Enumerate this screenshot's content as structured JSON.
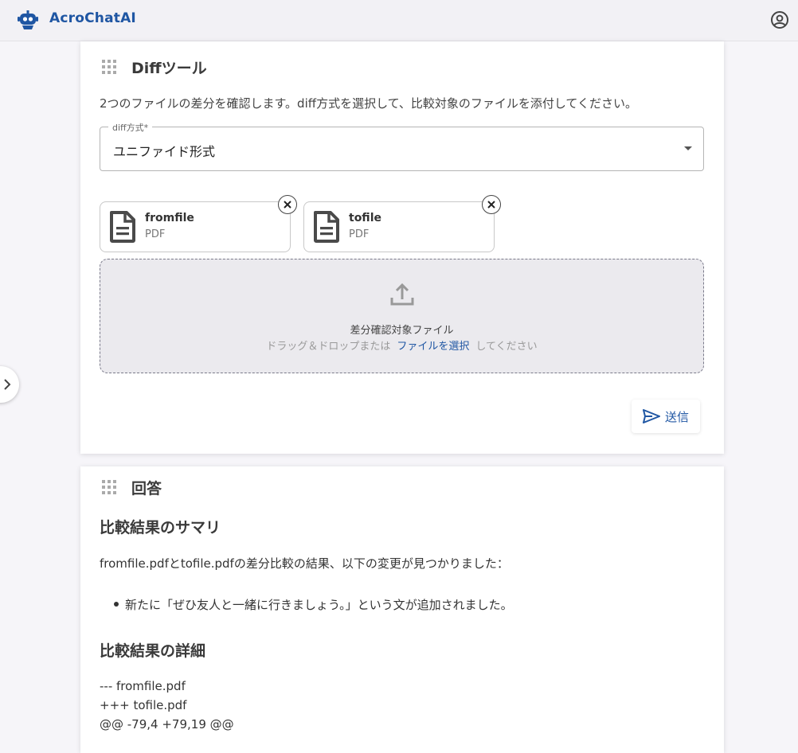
{
  "appbar": {
    "brand_name": "AcroChatAI",
    "logo_icon": "robot-icon",
    "account_icon": "account-circle-icon",
    "brand_color": "#1f56a3"
  },
  "side_toggle": {
    "icon": "chevron-right-icon"
  },
  "tool_card": {
    "title": "Diffツール",
    "description": "2つのファイルの差分を確認します。diff方式を選択して、比較対象のファイルを添付してください。",
    "select": {
      "label": "diff方式*",
      "value": "ユニファイド形式"
    },
    "files": [
      {
        "name": "fromfile",
        "type": "PDF"
      },
      {
        "name": "tofile",
        "type": "PDF"
      }
    ],
    "dropzone": {
      "title": "差分確認対象ファイル",
      "hint_before": "ドラッグ＆ドロップまたは",
      "hint_link": "ファイルを選択",
      "hint_after": "してください"
    },
    "send_label": "送信"
  },
  "answer_card": {
    "title": "回答",
    "heading_summary": "比較結果のサマリ",
    "summary_text": "fromfile.pdfとtofile.pdfの差分比較の結果、以下の変更が見つかりました：",
    "summary_items": [
      "新たに「ぜひ友人と一緒に行きましょう。」という文が追加されました。"
    ],
    "heading_detail": "比較結果の詳細",
    "diff_lines": [
      "--- fromfile.pdf",
      "+++ tofile.pdf",
      "@@ -79,4 +79,19 @@"
    ]
  }
}
